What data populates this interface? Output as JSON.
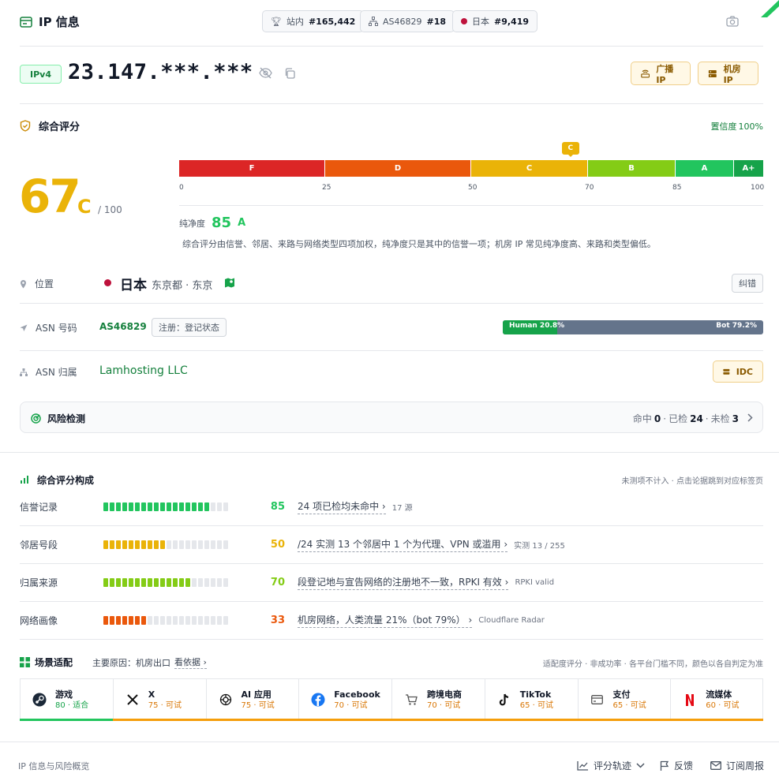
{
  "header": {
    "title": "IP 信息",
    "badges": [
      {
        "label": "站内",
        "value": "#165,442",
        "icon": "trophy-icon"
      },
      {
        "label": "AS46829",
        "value": "#18",
        "icon": "network-icon"
      },
      {
        "label": "日本",
        "value": "#9,419",
        "icon": "japan-flag-icon"
      }
    ]
  },
  "ip": {
    "version": "IPv4",
    "address": "23.147.***.***",
    "tags": [
      "广播 IP",
      "机房 IP"
    ]
  },
  "score": {
    "title": "综合评分",
    "confidence_label": "置信度",
    "confidence_value": "100%",
    "value": "67",
    "grade": "C",
    "max": "/ 100",
    "marker": "C",
    "segments": [
      {
        "label": "F",
        "from": 0,
        "to": 25,
        "color": "#dc2626"
      },
      {
        "label": "D",
        "from": 25,
        "to": 50,
        "color": "#ea580c"
      },
      {
        "label": "C",
        "from": 50,
        "to": 70,
        "color": "#eab308"
      },
      {
        "label": "B",
        "from": 70,
        "to": 85,
        "color": "#84cc16"
      },
      {
        "label": "A",
        "from": 85,
        "to": 95,
        "color": "#22c55e"
      },
      {
        "label": "A+",
        "from": 95,
        "to": 100,
        "color": "#16a34a"
      }
    ],
    "ticks": [
      "0",
      "25",
      "50",
      "70",
      "85",
      "100"
    ],
    "purity_label": "纯净度",
    "purity_value": "85",
    "purity_grade": "A",
    "note": "综合评分由信誉、邻居、来路与网络类型四项加权，纯净度只是其中的信誉一项；机房 IP 常见纯净度高、来路和类型偏低。"
  },
  "location": {
    "label": "位置",
    "country": "日本",
    "region": "东京都 · 东京",
    "fix_button": "纠错"
  },
  "asn": {
    "label": "ASN 号码",
    "number": "AS46829",
    "reg_chip": "注册：登记状态",
    "human": "Human 20.8%",
    "bot": "Bot 79.2%",
    "human_fraction": 0.208
  },
  "owner": {
    "label": "ASN 归属",
    "name": "Lamhosting LLC",
    "tag": "IDC"
  },
  "risk": {
    "title": "风险检测",
    "hit_label": "命中",
    "hit": "0",
    "checked_label": "已检",
    "checked": "24",
    "unchecked_label": "未检",
    "unchecked": "3"
  },
  "breakdown": {
    "title": "综合评分构成",
    "hint": "未测项不计入 · 点击论据跳到对应标签页",
    "rows": [
      {
        "label": "信誉记录",
        "score": "85",
        "fraction": 0.85,
        "color": "#22c55e",
        "desc": "24 项已检均未命中",
        "src": "17 源"
      },
      {
        "label": "邻居号段",
        "score": "50",
        "fraction": 0.5,
        "color": "#eab308",
        "desc": "/24 实测 13 个邻居中 1 个为代理、VPN 或滥用",
        "src": "实测 13 / 255"
      },
      {
        "label": "归属来源",
        "score": "70",
        "fraction": 0.7,
        "color": "#84cc16",
        "desc": "段登记地与宣告网络的注册地不一致，RPKI 有效",
        "src": "RPKI valid"
      },
      {
        "label": "网络画像",
        "score": "33",
        "fraction": 0.33,
        "color": "#ea580c",
        "desc": "机房网络，人类流量 21%（bot 79%）",
        "src": "Cloudflare Radar"
      }
    ]
  },
  "scenario": {
    "title": "场景适配",
    "reason_label": "主要原因：机房出口",
    "reason_link": "看依据",
    "hint": "适配度评分 · 非成功率 · 各平台门槛不同，颜色以各自判定为准",
    "cards": [
      {
        "name": "游戏",
        "score": "80 · 适合",
        "color": "#16a34a",
        "icon": "steam-icon"
      },
      {
        "name": "X",
        "score": "75 · 可试",
        "color": "#d97706",
        "icon": "x-icon"
      },
      {
        "name": "AI 应用",
        "score": "75 · 可试",
        "color": "#d97706",
        "icon": "openai-icon"
      },
      {
        "name": "Facebook",
        "score": "70 · 可试",
        "color": "#d97706",
        "icon": "facebook-icon"
      },
      {
        "name": "跨境电商",
        "score": "70 · 可试",
        "color": "#d97706",
        "icon": "cart-icon"
      },
      {
        "name": "TikTok",
        "score": "65 · 可试",
        "color": "#d97706",
        "icon": "tiktok-icon"
      },
      {
        "name": "支付",
        "score": "65 · 可试",
        "color": "#d97706",
        "icon": "card-icon"
      },
      {
        "name": "流媒体",
        "score": "60 · 可试",
        "color": "#d97706",
        "icon": "netflix-icon"
      }
    ]
  },
  "footer": {
    "left": "IP 信息与风险概览",
    "trend": "评分轨迹",
    "feedback": "反馈",
    "subscribe": "订阅周报"
  }
}
